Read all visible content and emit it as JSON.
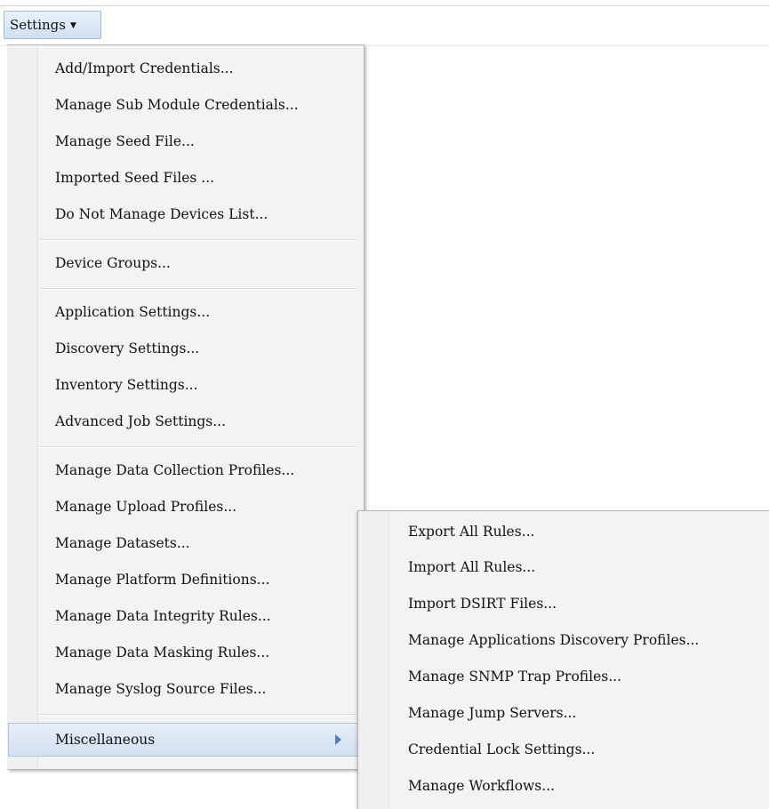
{
  "menubar": {
    "settings_label": "Settings",
    "caret": "▼"
  },
  "menu": {
    "group1": [
      "Add/Import Credentials...",
      "Manage Sub Module Credentials...",
      "Manage Seed File...",
      "Imported Seed Files ...",
      "Do Not Manage Devices List..."
    ],
    "group2": [
      "Device Groups..."
    ],
    "group3": [
      "Application Settings...",
      "Discovery Settings...",
      "Inventory Settings...",
      "Advanced Job Settings..."
    ],
    "group4": [
      "Manage Data Collection Profiles...",
      "Manage Upload Profiles...",
      "Manage Datasets...",
      "Manage Platform Definitions...",
      "Manage Data Integrity Rules...",
      "Manage Data Masking Rules...",
      "Manage Syslog Source Files..."
    ],
    "miscellaneous": {
      "label": "Miscellaneous",
      "arrow_icon": "triangle-right-icon"
    }
  },
  "submenu": {
    "items": [
      "Export All Rules...",
      "Import All Rules...",
      "Import DSIRT Files...",
      "Manage Applications Discovery Profiles...",
      "Manage SNMP Trap Profiles...",
      "Manage Jump Servers...",
      "Credential Lock Settings...",
      "Manage Workflows..."
    ]
  }
}
